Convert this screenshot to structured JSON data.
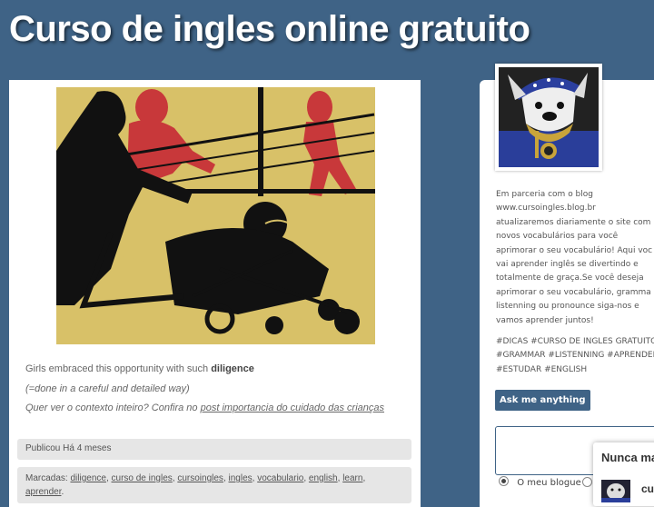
{
  "header": {
    "title": "Curso de ingles online gratuito"
  },
  "post": {
    "image_icon": "illustration-image",
    "line1_prefix": "Girls embraced this opportunity with such ",
    "line1_bold": "diligence",
    "line2": "(=done in a careful and detailed way)",
    "line3_prefix": "Quer ver o contexto inteiro? Confira no ",
    "line3_link": "post importancia do cuidado das crianças",
    "published": "Publicou Há 4 meses",
    "tags_label": "Marcadas: ",
    "tags": [
      "diligence",
      "curso de ingles",
      "cursoingles",
      "ingles",
      "vocabulario",
      "english",
      "learn",
      "aprender"
    ]
  },
  "sidebar": {
    "avatar_icon": "bulldog-avatar",
    "description": [
      "Em parceria com o blog",
      "www.cursoingles.blog.br",
      "atualizaremos diariamente o site com",
      "novos vocabulários para você",
      "aprimorar o seu vocabulário! Aqui voc",
      "vai aprender inglês se divertindo e",
      "totalmente de graça.Se você deseja",
      "aprimorar o seu vocabulário, gramma",
      "listenning ou pronounce siga-nos e",
      "vamos aprender juntos!"
    ],
    "hashtags": [
      "#DICAS #CURSO DE INGLES GRATUITO",
      "#GRAMMAR #LISTENNING #APRENDER",
      "#ESTUDAR #ENGLISH"
    ],
    "ask_button": "Ask me anything",
    "radio_label": "O meu blogue",
    "popup_title": "Nunca ma",
    "popup_user": "cu"
  },
  "colors": {
    "background": "#3f6386",
    "accent": "#3f6386"
  }
}
